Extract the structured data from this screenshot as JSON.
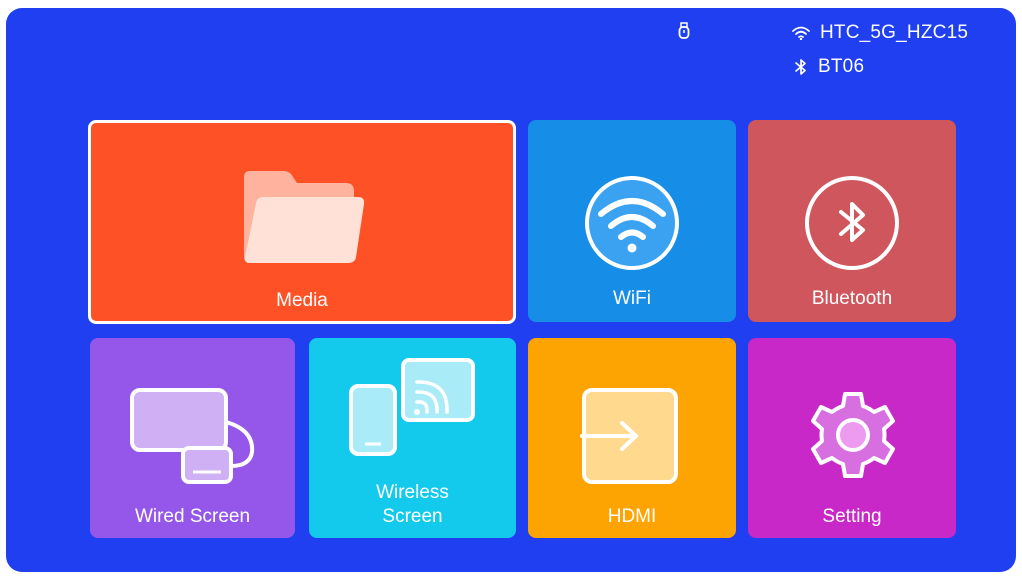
{
  "status_bar": {
    "usb_icon": "usb-icon",
    "wifi_icon": "wifi-signal-icon",
    "wifi_name": "HTC_5G_HZC15",
    "bluetooth_icon": "bluetooth-icon",
    "bluetooth_name": "BT06"
  },
  "tiles": [
    {
      "label": "Media",
      "icon": "folder-icon",
      "color": "#ff5126",
      "selected": true
    },
    {
      "label": "WiFi",
      "icon": "wifi-icon",
      "color": "#168de7"
    },
    {
      "label": "Bluetooth",
      "icon": "bluetooth-icon",
      "color": "#d0565d"
    },
    {
      "label": "Wired Screen",
      "icon": "wired-screen-icon",
      "color": "#9457e9"
    },
    {
      "label_line1": "Wireless",
      "label_line2": "Screen",
      "icon": "wireless-screen-icon",
      "color": "#13c9ec"
    },
    {
      "label": "HDMI",
      "icon": "hdmi-input-icon",
      "color": "#fea402"
    },
    {
      "label": "Setting",
      "icon": "gear-icon",
      "color": "#c828c8"
    }
  ],
  "colors": {
    "background": "#1f3ff0",
    "text": "#ffffff"
  }
}
